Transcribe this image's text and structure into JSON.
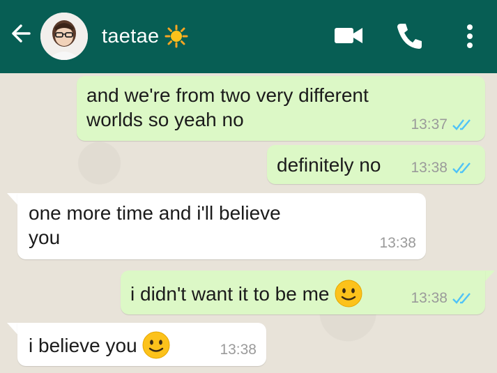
{
  "header": {
    "contact_name": "taetae",
    "name_emoji": "sun-emoji",
    "back_icon": "arrow-left-icon",
    "avatar_icon": "contact-avatar",
    "video_icon": "video-camera-icon",
    "phone_icon": "phone-icon",
    "menu_icon": "more-vertical-icon",
    "bg_color": "#075e54"
  },
  "messages": [
    {
      "direction": "out",
      "text_line1": "and we're from two very different",
      "text_line2": "worlds so yeah no",
      "time": "13:37",
      "read": true
    },
    {
      "direction": "out",
      "text": "definitely no",
      "time": "13:38",
      "read": true
    },
    {
      "direction": "in",
      "text_line1": "one more time and i'll believe",
      "text_line2": "you",
      "time": "13:38"
    },
    {
      "direction": "out",
      "text": "i didn't want it to be me",
      "emoji": "slightly-smiling-face",
      "time": "13:38",
      "read": true
    },
    {
      "direction": "in",
      "text": "i believe you",
      "emoji": "slightly-smiling-face",
      "time": "13:38"
    }
  ],
  "colors": {
    "outgoing_bubble": "#dcf8c6",
    "incoming_bubble": "#ffffff",
    "read_tick": "#4fc3f7"
  }
}
